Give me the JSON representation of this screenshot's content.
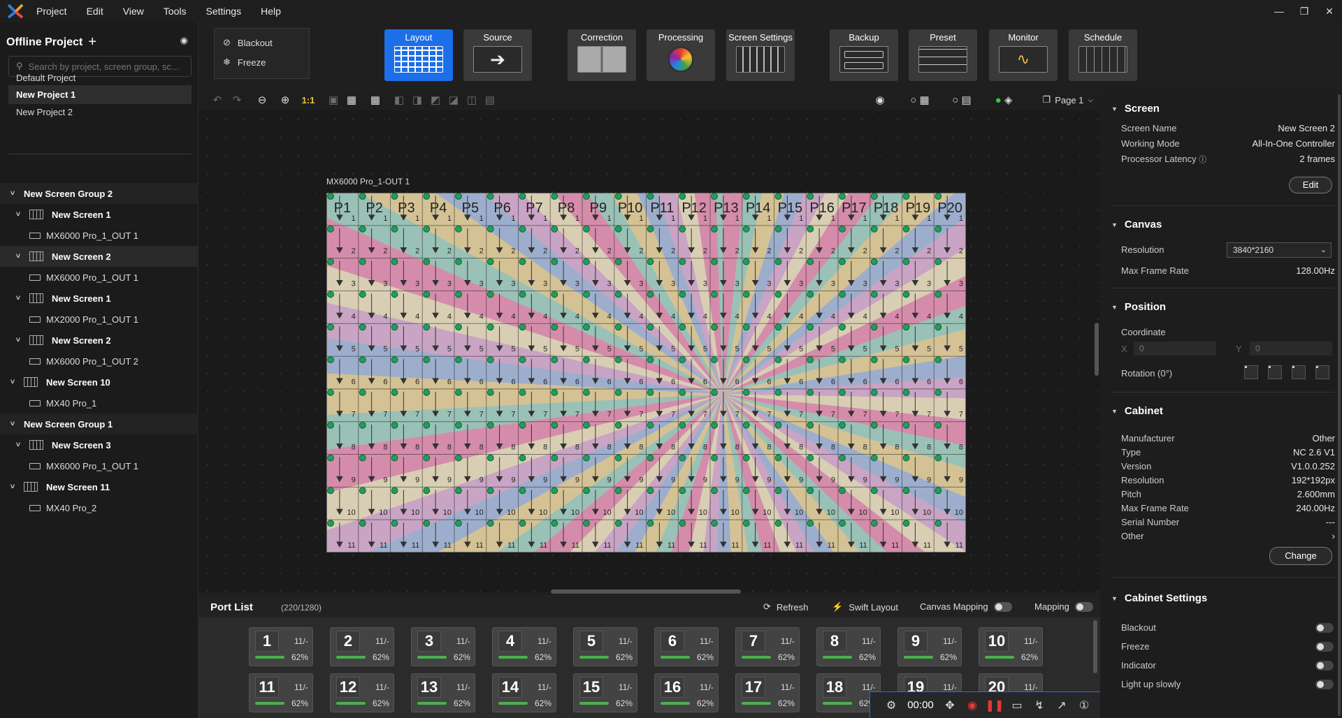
{
  "menubar": {
    "items": [
      "Project",
      "Edit",
      "View",
      "Tools",
      "Settings",
      "Help"
    ]
  },
  "left": {
    "project_title": "Offline Project",
    "search_placeholder": "Search by project, screen group, sc...",
    "projects": [
      {
        "label": "Default Project",
        "selected": false
      },
      {
        "label": "New Project 1",
        "selected": true
      },
      {
        "label": "New Project 2",
        "selected": false
      }
    ],
    "tree": [
      {
        "type": "group",
        "label": "New Screen Group 2"
      },
      {
        "type": "screen",
        "label": "New Screen 1"
      },
      {
        "type": "device",
        "label": "MX6000 Pro_1_OUT 1"
      },
      {
        "type": "screen",
        "label": "New Screen 2",
        "highlight": true
      },
      {
        "type": "device",
        "label": "MX6000 Pro_1_OUT 1"
      },
      {
        "type": "screen",
        "label": "New Screen 1"
      },
      {
        "type": "device",
        "label": "MX2000 Pro_1_OUT 1"
      },
      {
        "type": "screen",
        "label": "New Screen 2"
      },
      {
        "type": "device",
        "label": "MX6000 Pro_1_OUT 2"
      },
      {
        "type": "screen",
        "label": "New Screen 10"
      },
      {
        "type": "device",
        "label": "MX40 Pro_1"
      },
      {
        "type": "group",
        "label": "New Screen Group 1"
      },
      {
        "type": "screen",
        "label": "New Screen 3"
      },
      {
        "type": "device",
        "label": "MX6000 Pro_1_OUT 1"
      },
      {
        "type": "screen",
        "label": "New Screen 11"
      },
      {
        "type": "device",
        "label": "MX40 Pro_2"
      }
    ]
  },
  "ribbon": {
    "blackout": "Blackout",
    "freeze": "Freeze",
    "buttons": [
      {
        "label": "Layout",
        "active": true
      },
      {
        "label": "Source",
        "active": false
      },
      {
        "label": "Correction",
        "active": false
      },
      {
        "label": "Processing",
        "active": false
      },
      {
        "label": "Screen Settings",
        "active": false
      },
      {
        "label": "Backup",
        "active": false
      },
      {
        "label": "Preset",
        "active": false
      },
      {
        "label": "Monitor",
        "active": false
      },
      {
        "label": "Schedule",
        "active": false
      }
    ]
  },
  "toolbar": {
    "zoom_label": "1:1",
    "page_label": "Page 1"
  },
  "canvas": {
    "output_label": "MX6000 Pro_1-OUT 1",
    "columns": [
      "P1",
      "P2",
      "P3",
      "P4",
      "P5",
      "P6",
      "P7",
      "P8",
      "P9",
      "P10",
      "P11",
      "P12",
      "P13",
      "P14",
      "P15",
      "P16",
      "P17",
      "P18",
      "P19",
      "P20"
    ],
    "rows": 11
  },
  "ports": {
    "title": "Port List",
    "count": "(220/1280)",
    "refresh": "Refresh",
    "swift_layout": "Swift Layout",
    "canvas_mapping": "Canvas Mapping",
    "mapping": "Mapping",
    "items": [
      {
        "num": "1",
        "ratio": "11/-",
        "pct": "62%"
      },
      {
        "num": "2",
        "ratio": "11/-",
        "pct": "62%"
      },
      {
        "num": "3",
        "ratio": "11/-",
        "pct": "62%"
      },
      {
        "num": "4",
        "ratio": "11/-",
        "pct": "62%"
      },
      {
        "num": "5",
        "ratio": "11/-",
        "pct": "62%"
      },
      {
        "num": "6",
        "ratio": "11/-",
        "pct": "62%"
      },
      {
        "num": "7",
        "ratio": "11/-",
        "pct": "62%"
      },
      {
        "num": "8",
        "ratio": "11/-",
        "pct": "62%"
      },
      {
        "num": "9",
        "ratio": "11/-",
        "pct": "62%"
      },
      {
        "num": "10",
        "ratio": "11/-",
        "pct": "62%"
      },
      {
        "num": "11",
        "ratio": "11/-",
        "pct": "62%"
      },
      {
        "num": "12",
        "ratio": "11/-",
        "pct": "62%"
      },
      {
        "num": "13",
        "ratio": "11/-",
        "pct": "62%"
      },
      {
        "num": "14",
        "ratio": "11/-",
        "pct": "62%"
      },
      {
        "num": "15",
        "ratio": "11/-",
        "pct": "62%"
      },
      {
        "num": "16",
        "ratio": "11/-",
        "pct": "62%"
      },
      {
        "num": "17",
        "ratio": "11/-",
        "pct": "62%"
      },
      {
        "num": "18",
        "ratio": "11/-",
        "pct": "62%"
      },
      {
        "num": "19",
        "ratio": "11/-",
        "pct": ""
      },
      {
        "num": "20",
        "ratio": "11/-",
        "pct": ""
      }
    ],
    "usage_fraction": 0.62
  },
  "floatbar": {
    "time": "00:00"
  },
  "right": {
    "screen": {
      "title": "Screen",
      "name_label": "Screen Name",
      "name": "New Screen 2",
      "mode_label": "Working Mode",
      "mode": "All-In-One Controller",
      "latency_label": "Processor Latency",
      "latency": "2 frames",
      "edit": "Edit"
    },
    "canvas": {
      "title": "Canvas",
      "res_label": "Resolution",
      "resolution": "3840*2160",
      "fps_label": "Max Frame Rate",
      "fps": "128.00Hz"
    },
    "position": {
      "title": "Position",
      "coord_label": "Coordinate",
      "x_label": "X",
      "x": "0",
      "y_label": "Y",
      "y": "0",
      "rotation_label": "Rotation (0°)"
    },
    "cabinet": {
      "title": "Cabinet",
      "rows": [
        {
          "label": "Manufacturer",
          "value": "Other"
        },
        {
          "label": "Type",
          "value": "NC 2.6 V1"
        },
        {
          "label": "Version",
          "value": "V1.0.0.252"
        },
        {
          "label": "Resolution",
          "value": "192*192px"
        },
        {
          "label": "Pitch",
          "value": "2.600mm"
        },
        {
          "label": "Max Frame Rate",
          "value": "240.00Hz"
        },
        {
          "label": "Serial Number",
          "value": "---"
        },
        {
          "label": "Other",
          "value": "›"
        }
      ],
      "change": "Change"
    },
    "cabinet_settings": {
      "title": "Cabinet Settings",
      "items": [
        "Blackout",
        "Freeze",
        "Indicator",
        "Light up slowly"
      ]
    }
  },
  "colors": {
    "accent": "#1c6fe8",
    "bar": "#4caf50",
    "dot": "#1f9e5a"
  }
}
